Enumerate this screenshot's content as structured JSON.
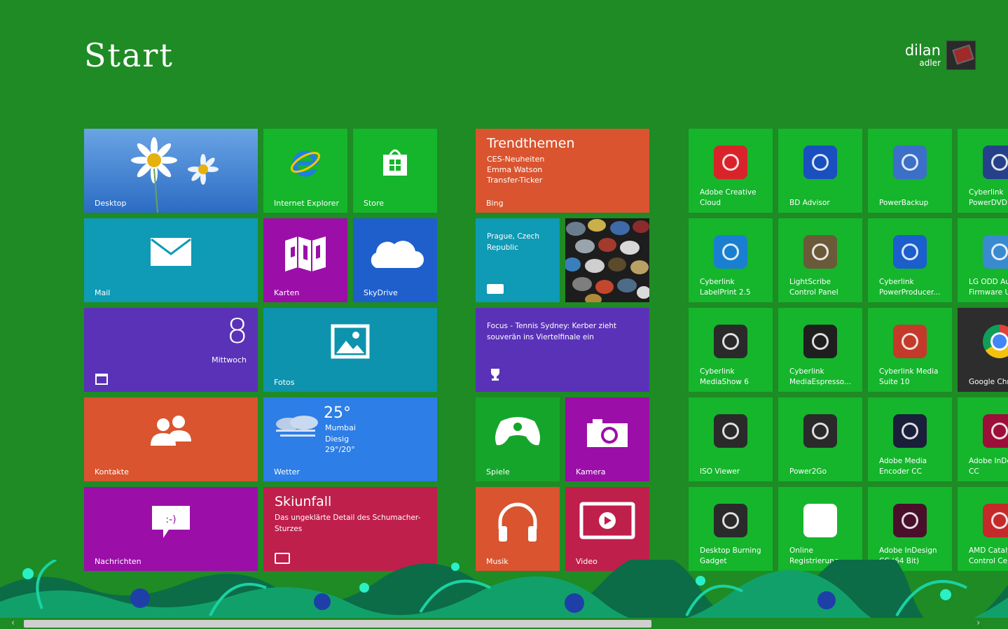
{
  "header": {
    "title": "Start",
    "user_name": "dilan",
    "user_sub": "adler"
  },
  "colors": {
    "background": "#1e8b24",
    "app_green": "#15b52c",
    "orange": "#d9542f",
    "teal": "#0f9ab5",
    "purple": "#5a32b8",
    "magenta": "#9b0fa8",
    "blue": "#1e5fcc",
    "crimson": "#bf1f4b",
    "sky": "#2d7ee6",
    "teal2": "#0d93ad"
  },
  "tiles": {
    "desktop": "Desktop",
    "ie": "Internet Explorer",
    "store": "Store",
    "mail": "Mail",
    "maps": "Karten",
    "skydrive": "SkyDrive",
    "calendar_day": "8",
    "calendar_weekday": "Mittwoch",
    "photos": "Fotos",
    "people": "Kontakte",
    "weather_temp": "25°",
    "weather_city": "Mumbai",
    "weather_cond": "Diesig",
    "weather_range": "29°/20°",
    "weather": "Wetter",
    "messaging": "Nachrichten",
    "news_headline": "Skiunfall",
    "news_body": "Das ungeklärte Detail des Schumacher-Sturzes",
    "bing_title": "Trendthemen",
    "bing_items": [
      "CES-Neuheiten",
      "Emma Watson",
      "Transfer-Ticker"
    ],
    "bing": "Bing",
    "travel": "Prague, Czech Republic",
    "sport": "Focus - Tennis Sydney: Kerber zieht souverän ins Viertelfinale ein",
    "games": "Spiele",
    "camera": "Kamera",
    "music": "Musik",
    "video": "Video"
  },
  "apps": [
    [
      "Adobe Creative Cloud",
      "BD Advisor",
      "PowerBackup",
      "Cyberlink PowerDVD"
    ],
    [
      "Cyberlink LabelPrint 2.5",
      "LightScribe Control Panel",
      "Cyberlink PowerProducer...",
      "LG ODD Auto Firmware U..."
    ],
    [
      "Cyberlink MediaShow 6",
      "Cyberlink MediaEspresso...",
      "Cyberlink Media Suite 10",
      "Google Chrome"
    ],
    [
      "ISO Viewer",
      "Power2Go",
      "Adobe Media Encoder CC",
      "Adobe InDesign CC"
    ],
    [
      "Desktop Burning Gadget",
      "Online Registrierung",
      "Adobe InDesign CC (64 Bit)",
      "AMD Catalyst Control Center"
    ]
  ]
}
